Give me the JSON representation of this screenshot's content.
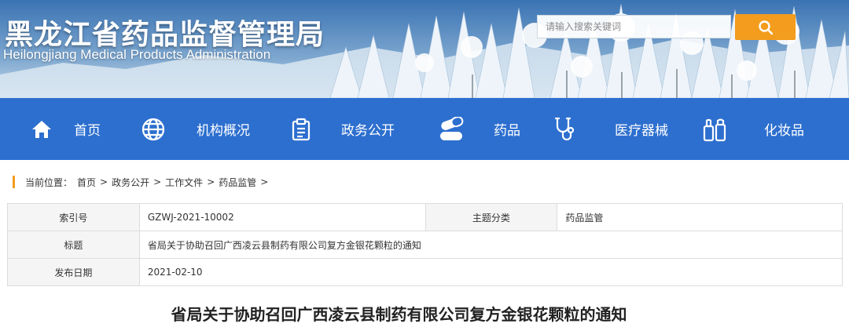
{
  "header": {
    "site_title": "黑龙江省药品监督管理局",
    "site_subtitle": "Heilongjiang Medical Products Administration",
    "search": {
      "placeholder": "请输入搜索关键词"
    }
  },
  "nav": {
    "items": [
      {
        "label": "首页",
        "icon": "home-icon"
      },
      {
        "label": "机构概况",
        "icon": "globe-icon"
      },
      {
        "label": "政务公开",
        "icon": "clipboard-icon"
      },
      {
        "label": "药品",
        "icon": "pills-icon"
      },
      {
        "label": "医疗器械",
        "icon": "stethoscope-icon"
      },
      {
        "label": "化妆品",
        "icon": "cosmetics-icon"
      }
    ]
  },
  "breadcrumb": {
    "prefix": "当前位置：",
    "items": [
      "首页",
      "政务公开",
      "工作文件",
      "药品监管"
    ],
    "separator": ">"
  },
  "info_table": {
    "index_label": "索引号",
    "index_value": "GZWJ-2021-10002",
    "category_label": "主题分类",
    "category_value": "药品监管",
    "title_label": "标题",
    "title_value": "省局关于协助召回广西凌云县制药有限公司复方金银花颗粒的通知",
    "date_label": "发布日期",
    "date_value": "2021-02-10"
  },
  "article": {
    "title": "省局关于协助召回广西凌云县制药有限公司复方金银花颗粒的通知"
  },
  "colors": {
    "nav_bg": "#2d6fcf",
    "accent": "#f39c1d",
    "table_key_bg": "#f5f5f5"
  }
}
